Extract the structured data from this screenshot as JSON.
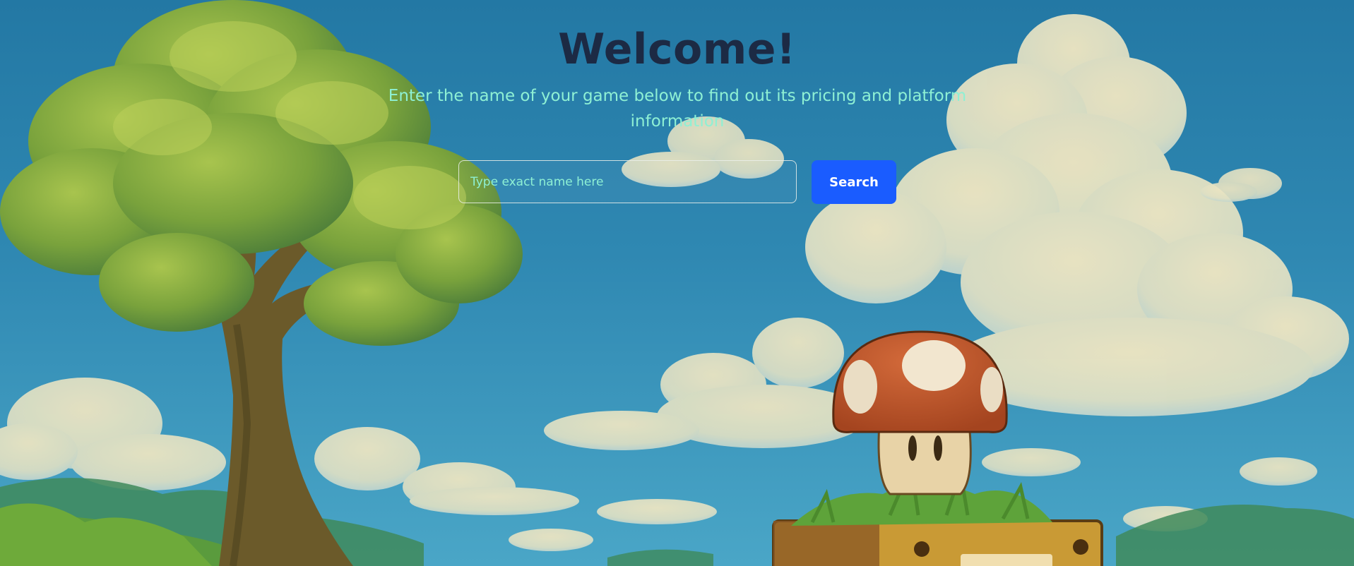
{
  "hero": {
    "title": "Welcome!",
    "subtitle": "Enter the name of your game below to find out its pricing and platform information"
  },
  "search": {
    "placeholder": "Type exact name here",
    "value": "",
    "button_label": "Search"
  },
  "colors": {
    "title": "#1c2a44",
    "subtitle": "#8ef0d4",
    "button": "#1a5cff",
    "sky": "#2f86ad"
  },
  "background": {
    "icons": [
      "tree-icon",
      "cloud-icon",
      "mushroom-icon",
      "question-block-icon",
      "hill-icon"
    ]
  }
}
